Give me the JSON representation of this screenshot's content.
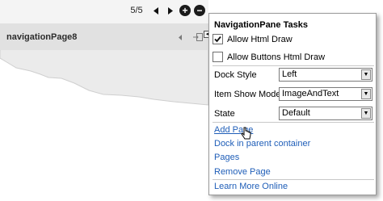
{
  "navigator": {
    "counter": "5/5",
    "prev_icon": "triangle-left-icon",
    "next_icon": "triangle-right-icon",
    "add_glyph": "+",
    "remove_glyph": "−"
  },
  "page": {
    "title": "navigationPage8"
  },
  "tasks": {
    "title": "NavigationPane Tasks",
    "allow_html_draw": {
      "label": "Allow Html Draw",
      "checked": true
    },
    "allow_buttons_html_draw": {
      "label": "Allow Buttons Html Draw",
      "checked": false
    },
    "dock_style": {
      "label": "Dock Style",
      "value": "Left"
    },
    "item_show_mode": {
      "label": "Item Show Mode",
      "value": "ImageAndText"
    },
    "state": {
      "label": "State",
      "value": "Default"
    },
    "links": {
      "add_page": "Add Page",
      "dock_in_parent": "Dock in parent container",
      "pages": "Pages",
      "remove_page": "Remove Page",
      "learn_more": "Learn More Online"
    }
  },
  "colors": {
    "link": "#1f5eb8",
    "header_band": "#e1e1e1",
    "surface": "#ececec"
  }
}
